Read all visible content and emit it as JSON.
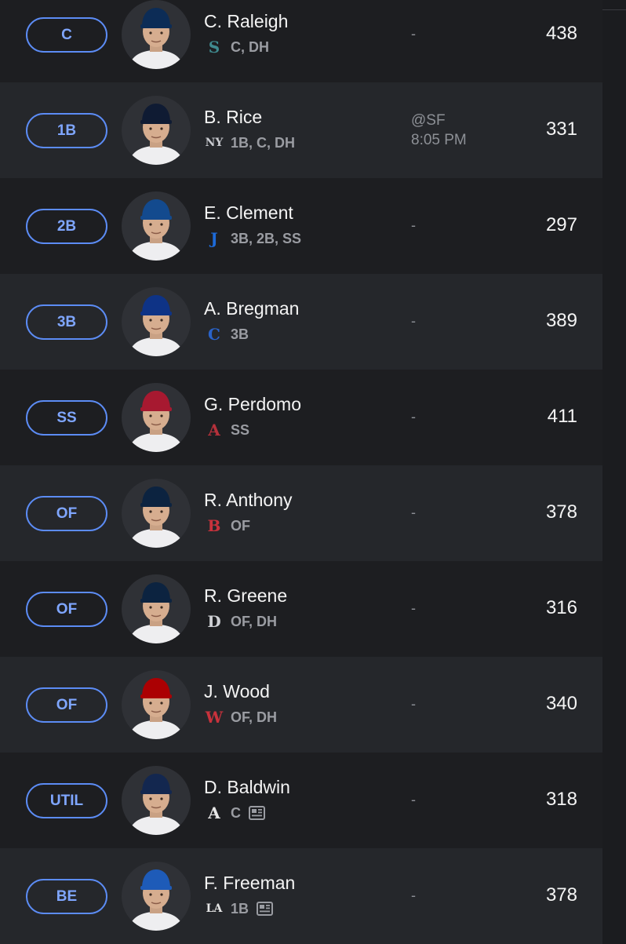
{
  "colors": {
    "accent": "#5c8cf5",
    "row_light": "#25272b",
    "row_dark": "#1d1e21"
  },
  "roster": [
    {
      "slot": "C",
      "name": "C. Raleigh",
      "team": "Mariners",
      "team_icon": "mariners-logo-icon",
      "team_glyph": "S",
      "team_color": "#3f8a8f",
      "positions": "C, DH",
      "game": [
        "-"
      ],
      "points": "438",
      "cap_color": "#0c2c56",
      "news": false
    },
    {
      "slot": "1B",
      "name": "B. Rice",
      "team": "Yankees",
      "team_icon": "yankees-logo-icon",
      "team_glyph": "NY",
      "team_color": "#c9cbd0",
      "positions": "1B, C, DH",
      "game": [
        "@SF",
        "8:05 PM"
      ],
      "points": "331",
      "cap_color": "#0f1b33",
      "news": false
    },
    {
      "slot": "2B",
      "name": "E. Clement",
      "team": "Blue Jays",
      "team_icon": "blue-jays-logo-icon",
      "team_glyph": "J",
      "team_color": "#1d6ad8",
      "positions": "3B, 2B, SS",
      "game": [
        "-"
      ],
      "points": "297",
      "cap_color": "#134a8e",
      "news": false
    },
    {
      "slot": "3B",
      "name": "A. Bregman",
      "team": "Cubs",
      "team_icon": "cubs-logo-icon",
      "team_glyph": "C",
      "team_color": "#2a63c9",
      "positions": "3B",
      "game": [
        "-"
      ],
      "points": "389",
      "cap_color": "#0e3386",
      "news": false
    },
    {
      "slot": "SS",
      "name": "G. Perdomo",
      "team": "Diamondbacks",
      "team_icon": "diamondbacks-logo-icon",
      "team_glyph": "A",
      "team_color": "#b5313b",
      "positions": "SS",
      "game": [
        "-"
      ],
      "points": "411",
      "cap_color": "#a71930",
      "news": false
    },
    {
      "slot": "OF",
      "name": "R. Anthony",
      "team": "Red Sox",
      "team_icon": "red-sox-logo-icon",
      "team_glyph": "B",
      "team_color": "#c8323c",
      "positions": "OF",
      "game": [
        "-"
      ],
      "points": "378",
      "cap_color": "#0c2340",
      "news": false
    },
    {
      "slot": "OF",
      "name": "R. Greene",
      "team": "Tigers",
      "team_icon": "tigers-logo-icon",
      "team_glyph": "D",
      "team_color": "#cfd1d5",
      "positions": "OF, DH",
      "game": [
        "-"
      ],
      "points": "316",
      "cap_color": "#0c2340",
      "news": false
    },
    {
      "slot": "OF",
      "name": "J. Wood",
      "team": "Nationals",
      "team_icon": "nationals-logo-icon",
      "team_glyph": "W",
      "team_color": "#c8323c",
      "positions": "OF, DH",
      "game": [
        "-"
      ],
      "points": "340",
      "cap_color": "#ab0003",
      "news": false
    },
    {
      "slot": "UTIL",
      "name": "D. Baldwin",
      "team": "Braves",
      "team_icon": "braves-logo-icon",
      "team_glyph": "A",
      "team_color": "#e6e6e6",
      "positions": "C",
      "game": [
        "-"
      ],
      "points": "318",
      "cap_color": "#13274f",
      "news": true
    },
    {
      "slot": "BE",
      "name": "F. Freeman",
      "team": "Dodgers",
      "team_icon": "dodgers-logo-icon",
      "team_glyph": "LA",
      "team_color": "#e6e6e6",
      "positions": "1B",
      "game": [
        "-"
      ],
      "points": "378",
      "cap_color": "#1e5bb8",
      "news": true
    }
  ]
}
